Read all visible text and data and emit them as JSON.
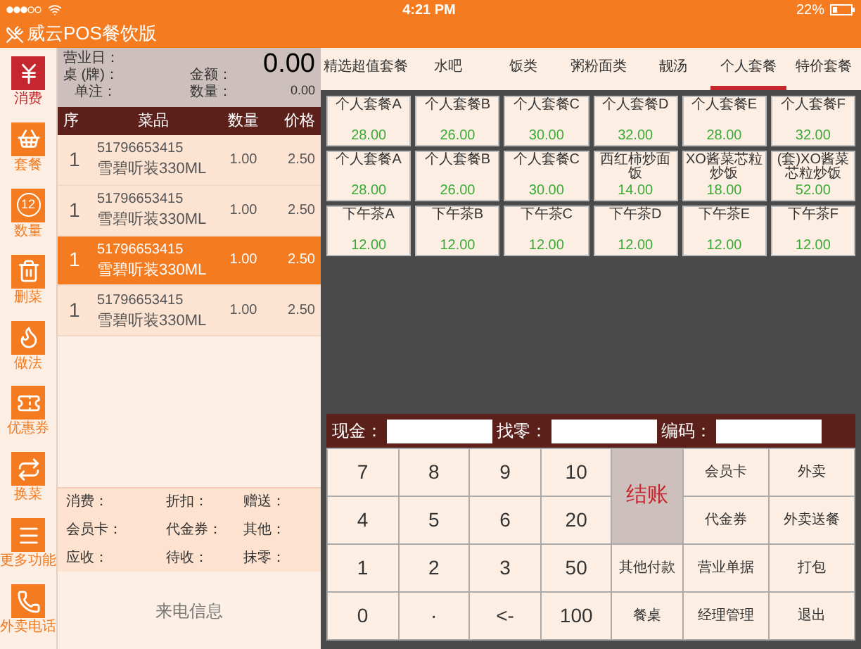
{
  "status_bar": {
    "time": "4:21 PM",
    "battery": "22%"
  },
  "app": {
    "title": "威云POS餐饮版"
  },
  "sidebar": {
    "items": [
      {
        "label": "消费",
        "selected": true
      },
      {
        "label": "套餐",
        "selected": false
      },
      {
        "label": "数量",
        "selected": false,
        "icon_text": "12"
      },
      {
        "label": "删菜",
        "selected": false
      },
      {
        "label": "做法",
        "selected": false
      },
      {
        "label": "优惠券",
        "selected": false
      },
      {
        "label": "换菜",
        "selected": false
      },
      {
        "label": "更多功能",
        "selected": false
      },
      {
        "label": "外卖电话",
        "selected": false
      }
    ]
  },
  "order": {
    "business_day": "营业日：",
    "table": "桌 (牌)：",
    "note": "单注：",
    "amount_label": "金额：",
    "amount": "0.00",
    "quantity_label": "数量：",
    "quantity": "0.00",
    "columns": [
      "序",
      "菜品",
      "数量",
      "价格"
    ],
    "rows": [
      {
        "no": "1",
        "code": "51796653415",
        "name": "雪碧听装330ML",
        "qty": "1.00",
        "price": "2.50",
        "selected": false
      },
      {
        "no": "1",
        "code": "51796653415",
        "name": "雪碧听装330ML",
        "qty": "1.00",
        "price": "2.50",
        "selected": false
      },
      {
        "no": "1",
        "code": "51796653415",
        "name": "雪碧听装330ML",
        "qty": "1.00",
        "price": "2.50",
        "selected": true
      },
      {
        "no": "1",
        "code": "51796653415",
        "name": "雪碧听装330ML",
        "qty": "1.00",
        "price": "2.50",
        "selected": false
      }
    ],
    "summary": [
      "消费：",
      "折扣：",
      "赠送：",
      "会员卡：",
      "代金券：",
      "其他：",
      "应收：",
      "待收：",
      "抹零："
    ],
    "caller_info": "来电信息"
  },
  "tabs": [
    {
      "label": "精选超值套餐",
      "selected": false
    },
    {
      "label": "水吧",
      "selected": false
    },
    {
      "label": "饭类",
      "selected": false
    },
    {
      "label": "粥粉面类",
      "selected": false
    },
    {
      "label": "靓汤",
      "selected": false
    },
    {
      "label": "个人套餐",
      "selected": true
    },
    {
      "label": "特价套餐",
      "selected": false
    }
  ],
  "menu_items": [
    {
      "name": "个人套餐A",
      "price": "28.00"
    },
    {
      "name": "个人套餐B",
      "price": "26.00"
    },
    {
      "name": "个人套餐C",
      "price": "30.00"
    },
    {
      "name": "个人套餐D",
      "price": "32.00"
    },
    {
      "name": "个人套餐E",
      "price": "28.00"
    },
    {
      "name": "个人套餐F",
      "price": "32.00"
    },
    {
      "name": "个人套餐A",
      "price": "28.00"
    },
    {
      "name": "个人套餐B",
      "price": "26.00"
    },
    {
      "name": "个人套餐C",
      "price": "30.00"
    },
    {
      "name": "西红柿炒面饭",
      "price": "14.00"
    },
    {
      "name": "XO酱菜芯粒炒饭",
      "price": "18.00"
    },
    {
      "name": "(套)XO酱菜芯粒炒饭",
      "price": "52.00"
    },
    {
      "name": "下午茶A",
      "price": "12.00"
    },
    {
      "name": "下午茶B",
      "price": "12.00"
    },
    {
      "name": "下午茶C",
      "price": "12.00"
    },
    {
      "name": "下午茶D",
      "price": "12.00"
    },
    {
      "name": "下午茶E",
      "price": "12.00"
    },
    {
      "name": "下午茶F",
      "price": "12.00"
    }
  ],
  "payment_fields": [
    {
      "label": "现金："
    },
    {
      "label": "找零："
    },
    {
      "label": "编码："
    }
  ],
  "keypad": [
    {
      "label": "7",
      "kind": "digit"
    },
    {
      "label": "8",
      "kind": "digit"
    },
    {
      "label": "9",
      "kind": "digit"
    },
    {
      "label": "10",
      "kind": "digit"
    },
    {
      "label": "结账",
      "kind": "checkout"
    },
    {
      "label": "会员卡",
      "kind": "function"
    },
    {
      "label": "外卖",
      "kind": "function"
    },
    {
      "label": "4",
      "kind": "digit"
    },
    {
      "label": "5",
      "kind": "digit"
    },
    {
      "label": "6",
      "kind": "digit"
    },
    {
      "label": "20",
      "kind": "digit"
    },
    {
      "label": "代金券",
      "kind": "function"
    },
    {
      "label": "外卖送餐",
      "kind": "function"
    },
    {
      "label": "1",
      "kind": "digit"
    },
    {
      "label": "2",
      "kind": "digit"
    },
    {
      "label": "3",
      "kind": "digit"
    },
    {
      "label": "50",
      "kind": "digit"
    },
    {
      "label": "其他付款",
      "kind": "function"
    },
    {
      "label": "营业单据",
      "kind": "function"
    },
    {
      "label": "打包",
      "kind": "function"
    },
    {
      "label": "0",
      "kind": "digit"
    },
    {
      "label": "·",
      "kind": "digit"
    },
    {
      "label": "<-",
      "kind": "digit"
    },
    {
      "label": "100",
      "kind": "digit"
    },
    {
      "label": "餐桌",
      "kind": "function"
    },
    {
      "label": "经理管理",
      "kind": "function"
    },
    {
      "label": "退出",
      "kind": "function"
    }
  ]
}
